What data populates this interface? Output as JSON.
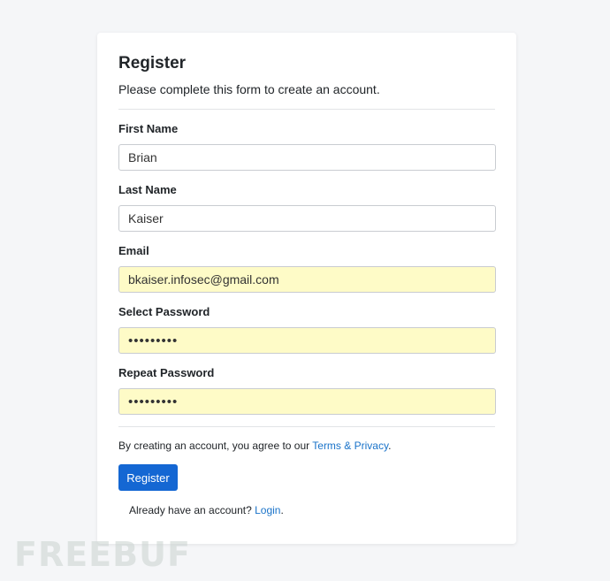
{
  "form": {
    "title": "Register",
    "subtitle": "Please complete this form to create an account.",
    "fields": [
      {
        "label": "First Name",
        "value": "Brian",
        "type": "text"
      },
      {
        "label": "Last Name",
        "value": "Kaiser",
        "type": "text"
      },
      {
        "label": "Email",
        "value": "bkaiser.infosec@gmail.com",
        "type": "email"
      },
      {
        "label": "Select Password",
        "value": "•••••••••",
        "type": "password"
      },
      {
        "label": "Repeat Password",
        "value": "•••••••••",
        "type": "password"
      }
    ],
    "agreement": {
      "text": "By creating an account, you agree to our ",
      "link": "Terms & Privacy",
      "end": "."
    },
    "submit_label": "Register",
    "login": {
      "text": "Already have an account? ",
      "link": "Login",
      "end": "."
    }
  },
  "watermark": "FREEBUF",
  "colors": {
    "primary": "#1467d3",
    "link": "#1a73c9",
    "autofill": "#fefbc7",
    "background": "#f5f6f8"
  }
}
